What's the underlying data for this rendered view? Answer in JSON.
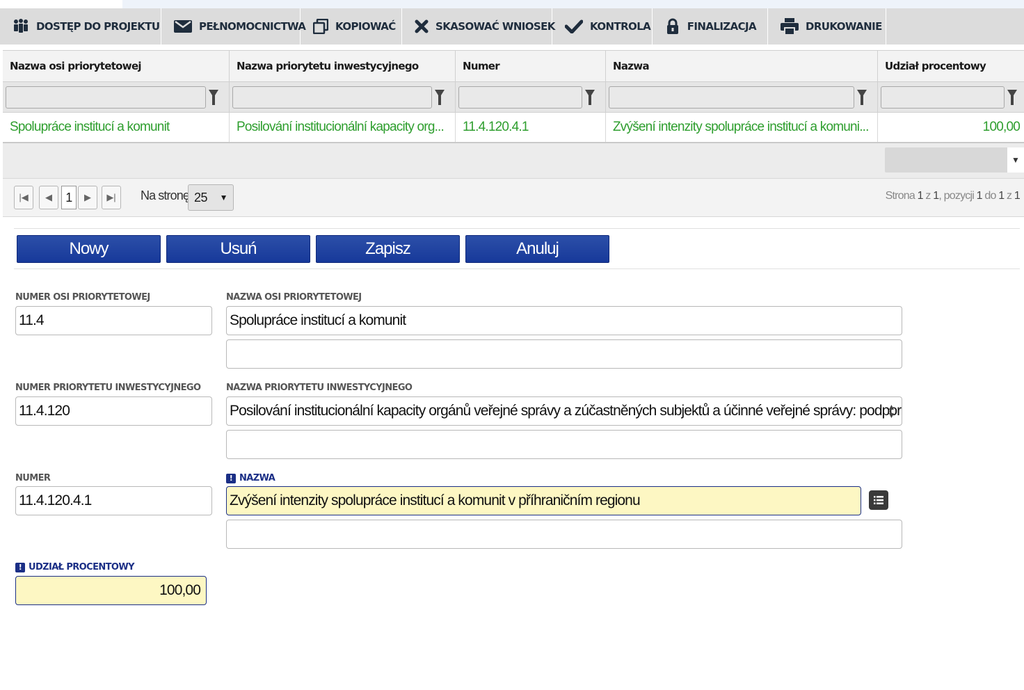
{
  "toolbar": {
    "items": [
      {
        "label": "DOSTĘP DO PROJEKTU",
        "icon": "people-icon"
      },
      {
        "label": "PEŁNOMOCNICTWA",
        "icon": "envelope-icon"
      },
      {
        "label": "KOPIOWAĆ",
        "icon": "copy-icon"
      },
      {
        "label": "SKASOWAĆ WNIOSEK",
        "icon": "delete-x-icon"
      },
      {
        "label": "KONTROLA",
        "icon": "checkmark-icon"
      },
      {
        "label": "FINALIZACJA",
        "icon": "lock-icon"
      },
      {
        "label": "DRUKOWANIE",
        "icon": "printer-icon"
      }
    ]
  },
  "grid": {
    "columns": [
      "Nazwa osi priorytetowej",
      "Nazwa priorytetu inwestycyjnego",
      "Numer",
      "Nazwa",
      "Udział procentowy"
    ],
    "rows": [
      [
        "Spolupráce institucí a komunit",
        "Posilování institucionální kapacity org...",
        "11.4.120.4.1",
        "Zvýšení intenzity spolupráce institucí a komuni...",
        "100,00"
      ]
    ],
    "text_color": "#2e9e2e"
  },
  "pager": {
    "current_page": "1",
    "per_page_label": "Na stronę",
    "per_page_value": "25",
    "info_prefix": "Strona",
    "info_page": "1",
    "info_of": "z",
    "info_total_pages": "1",
    "info_positions": ", pozycji",
    "info_from": "1",
    "info_to_word": "do",
    "info_to": "1",
    "info_of2": "z",
    "info_total": "1"
  },
  "actions": {
    "new_label": "Nowy",
    "delete_label": "Usuń",
    "save_label": "Zapisz",
    "cancel_label": "Anuluj",
    "color": "#1f3f9e"
  },
  "form": {
    "axis_number_label": "NUMER OSI PRIORYTETOWEJ",
    "axis_number_value": "11.4",
    "axis_name_label": "NAZWA OSI PRIORYTETOWEJ",
    "axis_name_value": "Spolupráce institucí a komunit",
    "axis_name_value2": "",
    "priority_number_label": "NUMER PRIORYTETU INWESTYCYJNEGO",
    "priority_number_value": "11.4.120",
    "priority_name_label": "NAZWA PRIORYTETU INWESTYCYJNEGO",
    "priority_name_value": "Posilování institucionální kapacity orgánů veřejné správy a zúčastněných subjektů a účinné veřejné správy: podporou",
    "priority_name_value2": "",
    "number_label": "NUMER",
    "number_value": "11.4.120.4.1",
    "name_label": "NAZWA",
    "name_value": "Zvýšení intenzity spolupráce institucí a komunit v příhraničním regionu",
    "name_value2": "",
    "share_label": "UDZIAŁ PROCENTOWY",
    "share_value": "100,00",
    "required_badge": "!",
    "required_bg": "#fdf7c3"
  }
}
